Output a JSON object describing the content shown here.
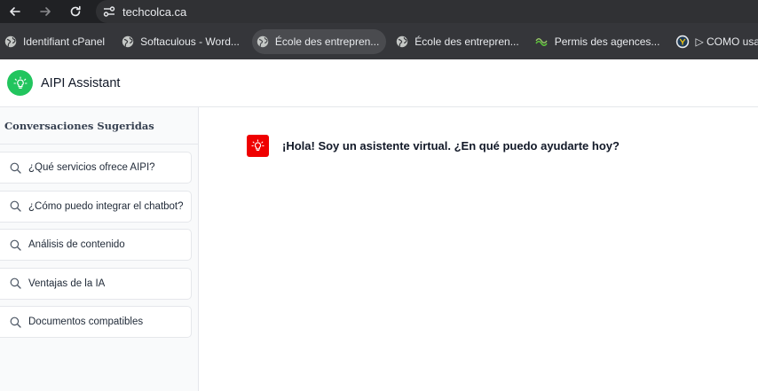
{
  "browser": {
    "url": "techcolca.ca",
    "nav": {
      "back_icon": "arrow-left-icon",
      "forward_icon": "arrow-right-icon",
      "reload_icon": "reload-icon",
      "site_info_icon": "tune-icon"
    },
    "bookmarks": [
      {
        "label": "Identifiant cPanel",
        "icon": "globe-icon",
        "active": false
      },
      {
        "label": "Softaculous - Word...",
        "icon": "globe-icon",
        "active": false
      },
      {
        "label": "École des entrepren...",
        "icon": "globe-icon",
        "active": true
      },
      {
        "label": "École des entrepren...",
        "icon": "globe-icon",
        "active": false
      },
      {
        "label": "Permis des agences...",
        "icon": "green-logo-icon",
        "active": false
      },
      {
        "label": "▷ COMO usar R",
        "icon": "circle-logo-icon",
        "active": false
      }
    ]
  },
  "app": {
    "title": "AIPI Assistant",
    "logo_icon": "lightbulb-icon",
    "colors": {
      "logo_bg": "#22c55e",
      "bot_avatar_bg": "#ef0000"
    }
  },
  "sidebar": {
    "title": "Conversaciones Sugeridas",
    "items": [
      {
        "label": "¿Qué servicios ofrece AIPI?",
        "icon": "search-icon"
      },
      {
        "label": "¿Cómo puedo integrar el chatbot?",
        "icon": "search-icon"
      },
      {
        "label": "Análisis de contenido",
        "icon": "search-icon"
      },
      {
        "label": "Ventajas de la IA",
        "icon": "search-icon"
      },
      {
        "label": "Documentos compatibles",
        "icon": "search-icon"
      }
    ]
  },
  "chat": {
    "messages": [
      {
        "sender": "bot",
        "text": "¡Hola! Soy un asistente virtual. ¿En qué puedo ayudarte hoy?"
      }
    ]
  }
}
